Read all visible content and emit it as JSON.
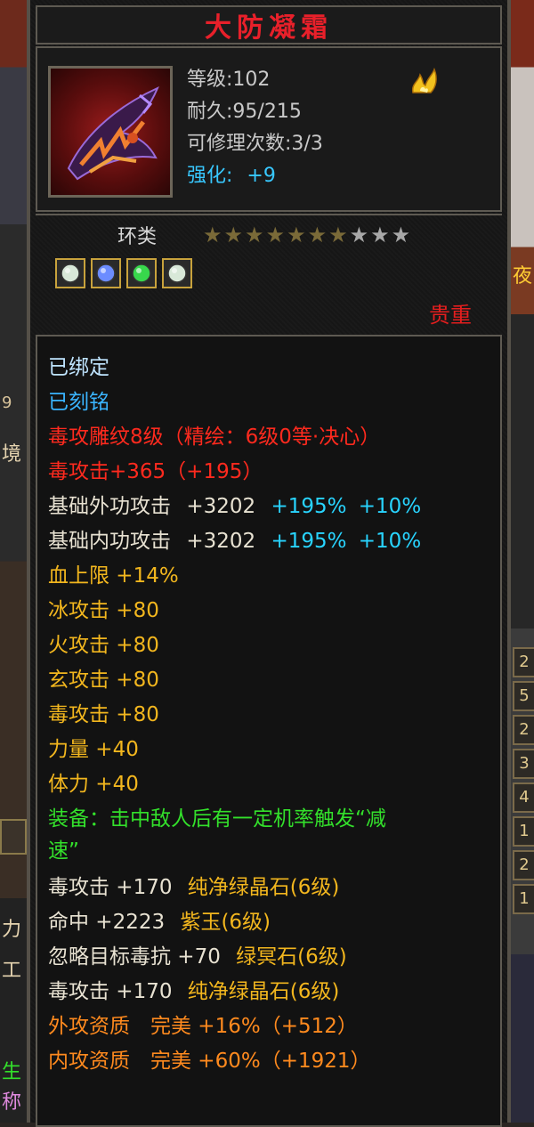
{
  "item": {
    "name": "大防凝霜",
    "level_text": "等级:102",
    "durability_text": "耐久:95/215",
    "repairs_text": "可修理次数:3/3",
    "enhance_label": "强化:",
    "enhance_value": "+9",
    "category": "环类",
    "stars_filled": 7,
    "stars_total": 10,
    "rarity": "贵重",
    "icon": "purple-orange-blade-ring-icon",
    "flame_icon": "golden-flame-icon"
  },
  "gems": [
    {
      "icon": "white-gem-icon",
      "color": "#d8e8d8"
    },
    {
      "icon": "blue-gem-icon",
      "color": "#6c8cff"
    },
    {
      "icon": "green-gem-icon",
      "color": "#38d84c"
    },
    {
      "icon": "white-gem-icon",
      "color": "#d8e8d8"
    }
  ],
  "details": {
    "bound": "已绑定",
    "engraved": "已刻铭",
    "carving": "毒攻雕纹8级（精绘：6级0等·决心）",
    "poison_attack_bonus": "毒攻击+365（+195）",
    "base_ext_atk": {
      "label": "基础外功攻击",
      "val": "+3202",
      "pct1": "+195%",
      "pct2": "+10%"
    },
    "base_int_atk": {
      "label": "基础内功攻击",
      "val": "+3202",
      "pct1": "+195%",
      "pct2": "+10%"
    },
    "yellow_stats": [
      "血上限 +14%",
      "冰攻击 +80",
      "火攻击 +80",
      "玄攻击 +80",
      "毒攻击 +80",
      "力量 +40",
      "体力 +40"
    ],
    "equip_effect_line1": "装备：击中敌人后有一定机率触发“减",
    "equip_effect_line2": "速”",
    "gem_stats": [
      {
        "text": "毒攻击 +170",
        "gem": "纯净绿晶石(6级)"
      },
      {
        "text": "命中 +2223",
        "gem": "紫玉(6级)"
      },
      {
        "text": "忽略目标毒抗 +70",
        "gem": "绿冥石(6级)"
      },
      {
        "text": "毒攻击 +170",
        "gem": "纯净绿晶石(6级)"
      }
    ],
    "quality": [
      "外攻资质　完美 +16%（+512）",
      "内攻资质　完美 +60%（+1921）"
    ]
  },
  "side": {
    "left_numbers": [
      "9"
    ],
    "left_chars": [
      "境",
      "力",
      "工",
      "生",
      "称"
    ],
    "right_numbers": [
      "2",
      "5",
      "2",
      "3",
      "4",
      "1",
      "2",
      "1"
    ],
    "right_top_char": "夜"
  }
}
